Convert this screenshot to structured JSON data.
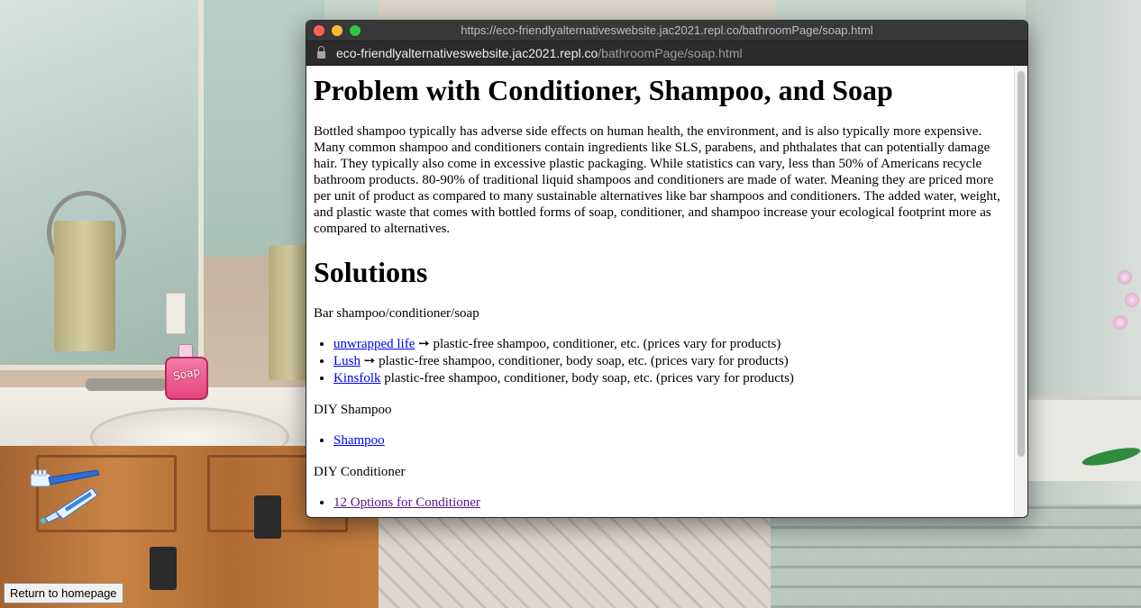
{
  "popup": {
    "title_url": "https://eco-friendlyalternativeswebsite.jac2021.repl.co/bathroomPage/soap.html",
    "url_host": "eco-friendlyalternativeswebsite.jac2021.repl.co",
    "url_path": "/bathroomPage/soap.html"
  },
  "page": {
    "heading1": "Problem with Conditioner, Shampoo, and Soap",
    "problem_text": "Bottled shampoo typically has adverse side effects on human health, the environment, and is also typically more expensive. Many common shampoo and conditioners contain ingredients like SLS, parabens, and phthalates that can potentially damage hair. They typically also come in excessive plastic packaging. While statistics can vary, less than 50% of Americans recycle bathroom products. 80-90% of traditional liquid shampoos and conditioners are made of water. Meaning they are priced more per unit of product as compared to many sustainable alternatives like bar shampoos and conditioners. The added water, weight, and plastic waste that comes with bottled forms of soap, conditioner, and shampoo increase your ecological footprint more as compared to alternatives.",
    "heading2": "Solutions",
    "bar_section_label": "Bar shampoo/conditioner/soap",
    "bar_links": [
      {
        "link": "unwrapped life",
        "text": " ➙ plastic-free shampoo, conditioner, etc. (prices vary for products)"
      },
      {
        "link": "Lush",
        "text": " ➙ plastic-free shampoo, conditioner, body soap, etc. (prices vary for products)"
      },
      {
        "link": "Kinsfolk",
        "text": " plastic-free shampoo, conditioner, body soap, etc. (prices vary for products)"
      }
    ],
    "diy_shampoo_label": "DIY Shampoo",
    "diy_shampoo_link": "Shampoo",
    "diy_conditioner_label": "DIY Conditioner",
    "diy_conditioner_link": "12 Options for Conditioner"
  },
  "scene": {
    "soap_label": "Soap",
    "return_button": "Return to homepage"
  }
}
